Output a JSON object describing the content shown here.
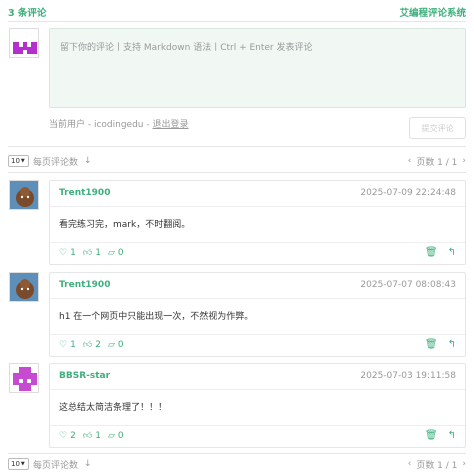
{
  "header": {
    "count": "3 条评论",
    "brand": "艾编程评论系统"
  },
  "editor": {
    "placeholder": "留下你的评论丨支持 Markdown 语法丨Ctrl + Enter 发表评论"
  },
  "session": {
    "label": "当前用户 - icodingedu - ",
    "logout": "退出登录"
  },
  "submit_label": "提交评论",
  "pager": {
    "per_page_value": "10",
    "per_page_label": "每页评论数",
    "page_label": "页数 1 / 1"
  },
  "comments": [
    {
      "user": "Trent1900",
      "time": "2025-07-09 22:24:48",
      "body": "看完练习完，mark，不时翻阅。",
      "likes": "1",
      "ups": "1",
      "comments": "0"
    },
    {
      "user": "Trent1900",
      "time": "2025-07-07 08:08:43",
      "body": "h1 在一个网页中只能出现一次，不然视为作弊。",
      "likes": "1",
      "ups": "2",
      "comments": "0"
    },
    {
      "user": "BBSR-star",
      "time": "2025-07-03 19:11:58",
      "body": "这总结太简洁条理了！！！",
      "likes": "2",
      "ups": "1",
      "comments": "0"
    }
  ],
  "colors": {
    "accent": "#3eaf7c",
    "avatar_purple": "#b52fcf",
    "avatar_pink": "#c74ad3"
  }
}
